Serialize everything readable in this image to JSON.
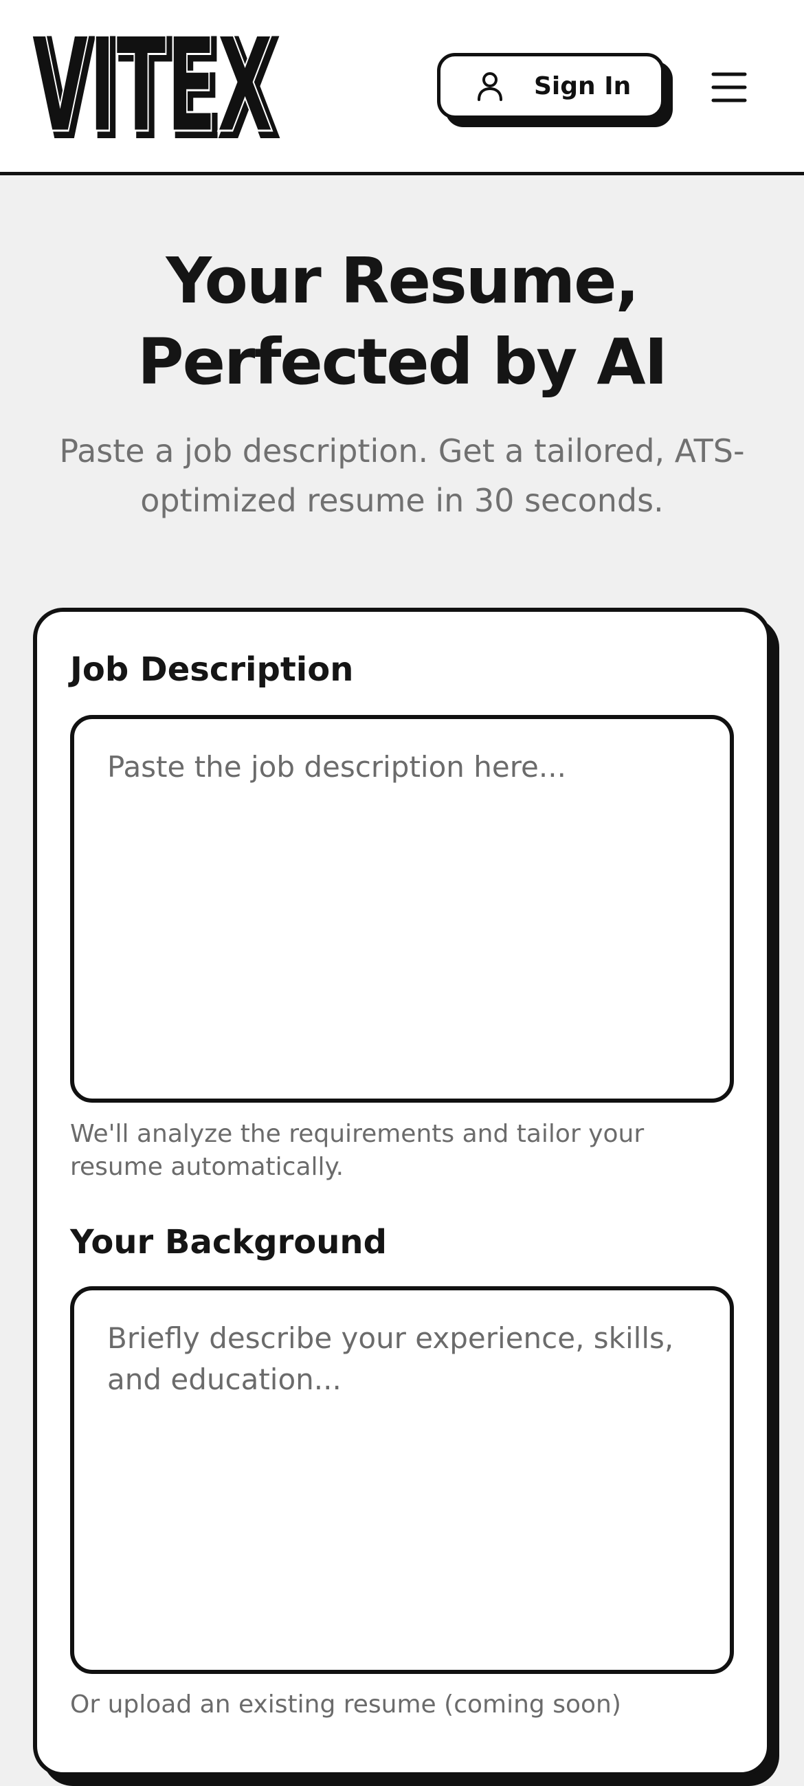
{
  "header": {
    "logo_text": "VITEX",
    "signin_label": "Sign In",
    "signin_icon": "user-icon",
    "menu_icon": "hamburger-menu-icon"
  },
  "hero": {
    "title": "Your Resume, Perfected by AI",
    "subtitle": "Paste a job description. Get a tailored, ATS-optimized resume in 30 seconds."
  },
  "form": {
    "job_description": {
      "label": "Job Description",
      "value": "",
      "placeholder": "Paste the job description here...",
      "helper": "We'll analyze the requirements and tailor your resume automatically."
    },
    "background": {
      "label": "Your Background",
      "value": "",
      "placeholder": "Briefly describe your experience, skills, and education...",
      "helper": "Or upload an existing resume (coming soon)"
    }
  },
  "colors": {
    "ink": "#111111",
    "page_background": "#f0f0f0",
    "surface": "#ffffff",
    "muted_text": "#6b6b6b"
  }
}
